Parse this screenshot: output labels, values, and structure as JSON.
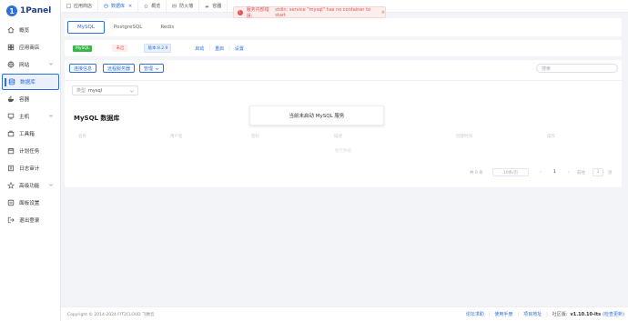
{
  "app": {
    "logo_mark": "1",
    "logo_text": "1Panel"
  },
  "sidebar": {
    "items": [
      {
        "label": "概览",
        "icon": "home-icon"
      },
      {
        "label": "应用商店",
        "icon": "store-icon"
      },
      {
        "label": "网站",
        "icon": "globe-icon"
      },
      {
        "label": "数据库",
        "icon": "database-icon"
      },
      {
        "label": "容器",
        "icon": "container-icon"
      },
      {
        "label": "主机",
        "icon": "host-icon"
      },
      {
        "label": "工具箱",
        "icon": "toolbox-icon"
      },
      {
        "label": "计划任务",
        "icon": "calendar-icon"
      },
      {
        "label": "日志审计",
        "icon": "log-icon"
      },
      {
        "label": "高级功能",
        "icon": "star-icon"
      },
      {
        "label": "面板设置",
        "icon": "settings-icon"
      },
      {
        "label": "退出登录",
        "icon": "logout-icon"
      }
    ]
  },
  "topbar": {
    "tabs": [
      {
        "label": "应用商店"
      },
      {
        "label": "数据库",
        "close": "×"
      },
      {
        "label": "概览"
      },
      {
        "label": "防火墙"
      },
      {
        "label": "容器"
      }
    ]
  },
  "toast": {
    "prefix": "服务内部错误:",
    "message": "stdin: service \"mysql\" has no container to start",
    "close": "×"
  },
  "subtabs": [
    "MySQL",
    "PostgreSQL",
    "Redis"
  ],
  "status": {
    "name": "MySQL",
    "state": "未启",
    "version": "版本:8.2.9",
    "actions": [
      "启动",
      "重启",
      "设置"
    ],
    "sep": "|"
  },
  "toolbar": {
    "conn_info": "连接信息",
    "remote": "远程服务器",
    "manage": "管理",
    "search_placeholder": "搜索"
  },
  "filter": {
    "label": "类型",
    "value": "mysql"
  },
  "section": {
    "title": "MySQL 数据库"
  },
  "table": {
    "headers": [
      "名称",
      "用户名",
      "密码",
      "描述",
      "创建时间",
      "操作"
    ],
    "empty": "暂无数据"
  },
  "pagination": {
    "total": "共 0 条",
    "per_page": "10条/页",
    "prev": "‹",
    "page": "1",
    "next": "›",
    "goto": "前往",
    "goto_value": "1",
    "page_unit": "页"
  },
  "popup": {
    "message": "当前未启动 MySQL 服务"
  },
  "footer": {
    "copyright": "Copyright © 2014-2024 FIT2CLOUD 飞致云",
    "links": [
      "论坛求助",
      "使用手册",
      "项目地址"
    ],
    "community_label": "社区版:",
    "version": "v1.10.10-lts",
    "update": "(检查更新)"
  },
  "colors": {
    "accent": "#2f6fd6",
    "success": "#3bb44a",
    "danger": "#e25353",
    "background": "#f3f4f7"
  }
}
